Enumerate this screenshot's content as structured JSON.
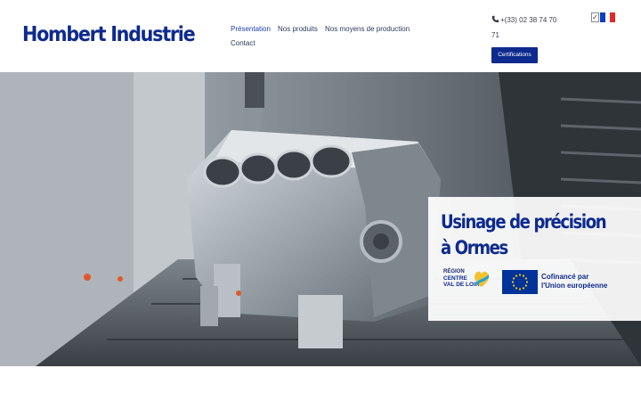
{
  "site": {
    "brand": "Hombert Industrie"
  },
  "nav": {
    "items": [
      {
        "label": "Présentation",
        "active": true
      },
      {
        "label": "Nos produits",
        "active": false
      },
      {
        "label": "Nos moyens de production",
        "active": false
      },
      {
        "label": "Contact",
        "active": false
      }
    ]
  },
  "contact": {
    "phone": "+(33) 02 38 74 70 71",
    "icon": "phone-icon"
  },
  "buttons": {
    "certifications": "Certifications"
  },
  "lang": {
    "selector_icon": "checkbox-icon",
    "current": "flag-fr-icon"
  },
  "hero": {
    "image": "cnc-machining-engine-block",
    "title_line1": "Usinage de précision",
    "title_line2": "à Ormes",
    "partners": {
      "region_line1": "RÉGION",
      "region_line2": "CENTRE",
      "region_line3": "VAL DE LOIRE",
      "eu_line1": "Cofinancé par",
      "eu_line2": "l'Union européenne"
    }
  },
  "colors": {
    "brand": "#0d2a8e",
    "button": "#0d2a8e",
    "eu_blue": "#003399",
    "eu_gold": "#ffcc00"
  }
}
